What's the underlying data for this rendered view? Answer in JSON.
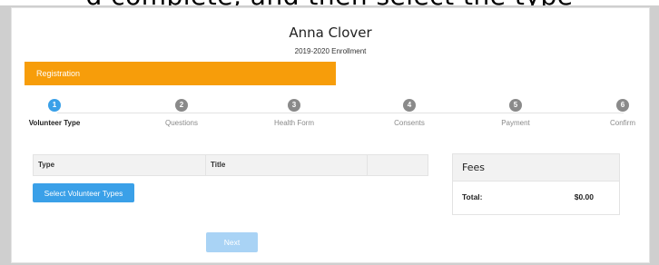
{
  "caption": "d complete, and then select the type",
  "header": {
    "name": "Anna Clover",
    "subtitle": "2019-2020 Enrollment"
  },
  "banner": {
    "label": "Registration"
  },
  "steps": [
    {
      "num": "1",
      "label": "Volunteer Type",
      "active": true
    },
    {
      "num": "2",
      "label": "Questions",
      "active": false
    },
    {
      "num": "3",
      "label": "Health Form",
      "active": false
    },
    {
      "num": "4",
      "label": "Consents",
      "active": false
    },
    {
      "num": "5",
      "label": "Payment",
      "active": false
    },
    {
      "num": "6",
      "label": "Confirm",
      "active": false
    }
  ],
  "types_table": {
    "columns": [
      "Type",
      "Title",
      ""
    ]
  },
  "buttons": {
    "select_types": "Select Volunteer Types",
    "next": "Next"
  },
  "fees": {
    "title": "Fees",
    "total_label": "Total:",
    "total_value": "$0.00"
  },
  "colors": {
    "accent": "#3aa0e8",
    "banner": "#f79d0a",
    "next_disabled": "#a9d3f5"
  }
}
